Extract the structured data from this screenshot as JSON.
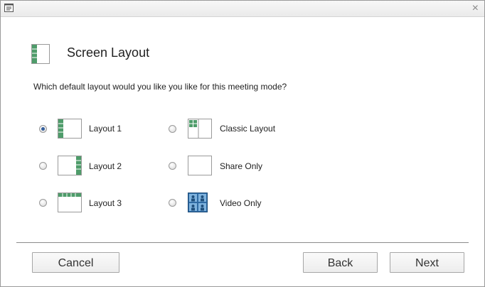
{
  "window": {
    "close_glyph": "×"
  },
  "header": {
    "title": "Screen Layout",
    "icon": "screen-layout-icon"
  },
  "question": "Which default layout would you like you like for this meeting mode?",
  "options": [
    {
      "label": "Layout 1",
      "icon": "layout-1-icon",
      "selected": true
    },
    {
      "label": "Classic Layout",
      "icon": "classic-layout-icon",
      "selected": false
    },
    {
      "label": "Layout 2",
      "icon": "layout-2-icon",
      "selected": false
    },
    {
      "label": "Share Only",
      "icon": "share-only-icon",
      "selected": false
    },
    {
      "label": "Layout 3",
      "icon": "layout-3-icon",
      "selected": false
    },
    {
      "label": "Video Only",
      "icon": "video-only-icon",
      "selected": false
    }
  ],
  "buttons": {
    "cancel": "Cancel",
    "back": "Back",
    "next": "Next"
  },
  "colors": {
    "accent": "#355f9c",
    "film_strip": "#4e9c6a",
    "video_tile": "#3a78b0"
  }
}
